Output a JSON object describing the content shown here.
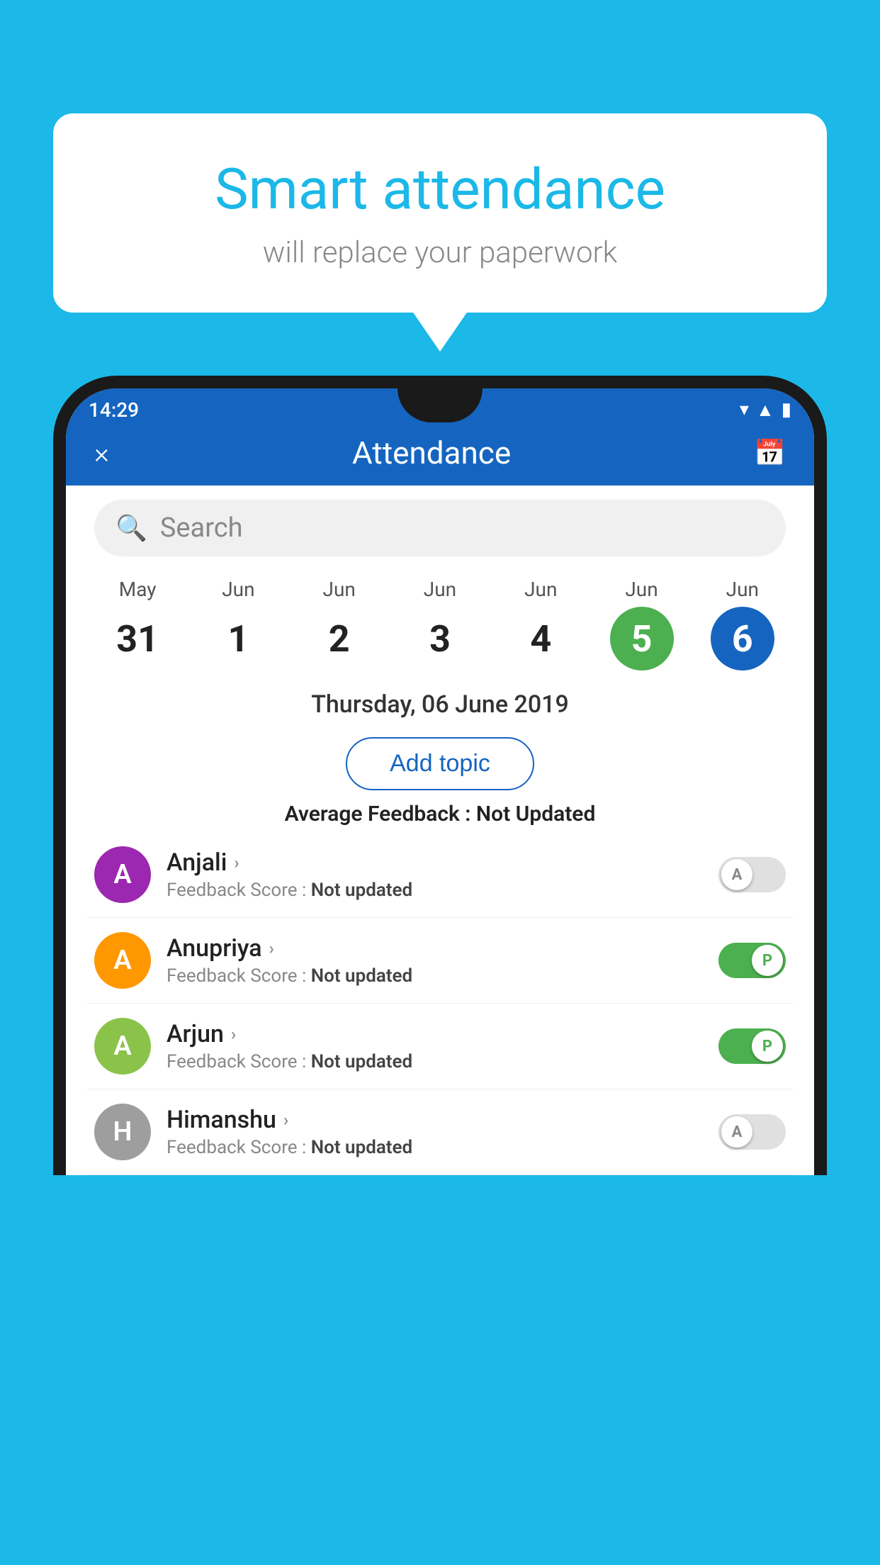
{
  "background_color": "#1BB8E8",
  "bubble": {
    "title": "Smart attendance",
    "subtitle": "will replace your paperwork"
  },
  "status_bar": {
    "time": "14:29",
    "icons": [
      "wifi",
      "signal",
      "battery"
    ]
  },
  "header": {
    "title": "Attendance",
    "close_label": "×",
    "calendar_icon": "📅"
  },
  "search": {
    "placeholder": "Search"
  },
  "dates": [
    {
      "month": "May",
      "day": "31",
      "selected": ""
    },
    {
      "month": "Jun",
      "day": "1",
      "selected": ""
    },
    {
      "month": "Jun",
      "day": "2",
      "selected": ""
    },
    {
      "month": "Jun",
      "day": "3",
      "selected": ""
    },
    {
      "month": "Jun",
      "day": "4",
      "selected": ""
    },
    {
      "month": "Jun",
      "day": "5",
      "selected": "green"
    },
    {
      "month": "Jun",
      "day": "6",
      "selected": "blue"
    }
  ],
  "selected_date": "Thursday, 06 June 2019",
  "add_topic_label": "Add topic",
  "avg_feedback_label": "Average Feedback : ",
  "avg_feedback_value": "Not Updated",
  "students": [
    {
      "name": "Anjali",
      "avatar_letter": "A",
      "avatar_color": "#9C27B0",
      "feedback_label": "Feedback Score : ",
      "feedback_value": "Not updated",
      "toggle_state": "off",
      "toggle_letter": "A"
    },
    {
      "name": "Anupriya",
      "avatar_letter": "A",
      "avatar_color": "#FF9800",
      "feedback_label": "Feedback Score : ",
      "feedback_value": "Not updated",
      "toggle_state": "on",
      "toggle_letter": "P"
    },
    {
      "name": "Arjun",
      "avatar_letter": "A",
      "avatar_color": "#8BC34A",
      "feedback_label": "Feedback Score : ",
      "feedback_value": "Not updated",
      "toggle_state": "on",
      "toggle_letter": "P"
    },
    {
      "name": "Himanshu",
      "avatar_letter": "H",
      "avatar_color": "#9E9E9E",
      "feedback_label": "Feedback Score : ",
      "feedback_value": "Not updated",
      "toggle_state": "off",
      "toggle_letter": "A"
    }
  ]
}
